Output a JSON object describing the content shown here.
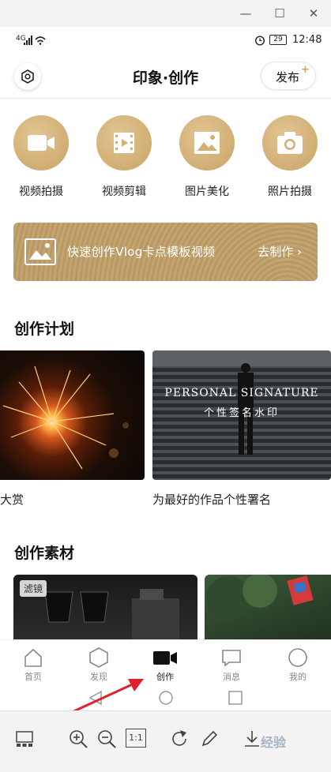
{
  "window": {
    "controls": [
      "minimize",
      "maximize",
      "close"
    ]
  },
  "statusbar": {
    "signal": "4G",
    "battery": "29",
    "time": "12:48"
  },
  "header": {
    "title": "印象·创作",
    "publish_label": "发布",
    "publish_badge": "+"
  },
  "tools": [
    {
      "label": "视频拍摄",
      "icon": "video-camera-icon"
    },
    {
      "label": "视频剪辑",
      "icon": "film-icon"
    },
    {
      "label": "图片美化",
      "icon": "image-icon"
    },
    {
      "label": "照片拍摄",
      "icon": "camera-icon"
    }
  ],
  "banner": {
    "text": "快速创作Vlog卡点模板视频",
    "cta": "去制作 ›"
  },
  "plan": {
    "title": "创作计划",
    "cards": [
      {
        "caption": "大赏"
      },
      {
        "caption": "为最好的作品个性署名",
        "overlay_en": "PERSONAL SIGNATURE",
        "overlay_cn": "个性签名水印"
      }
    ]
  },
  "materials": {
    "title": "创作素材",
    "tag": "滤镜"
  },
  "tabs": [
    {
      "label": "首页",
      "icon": "home-icon"
    },
    {
      "label": "发现",
      "icon": "hexagon-icon"
    },
    {
      "label": "创作",
      "icon": "video-camera-icon",
      "active": true
    },
    {
      "label": "消息",
      "icon": "message-icon"
    },
    {
      "label": "我的",
      "icon": "profile-icon"
    }
  ],
  "watermark": "经验",
  "colors": {
    "gold": "#c9a466",
    "active_tab": "#222222",
    "arrow": "#e0202a"
  }
}
